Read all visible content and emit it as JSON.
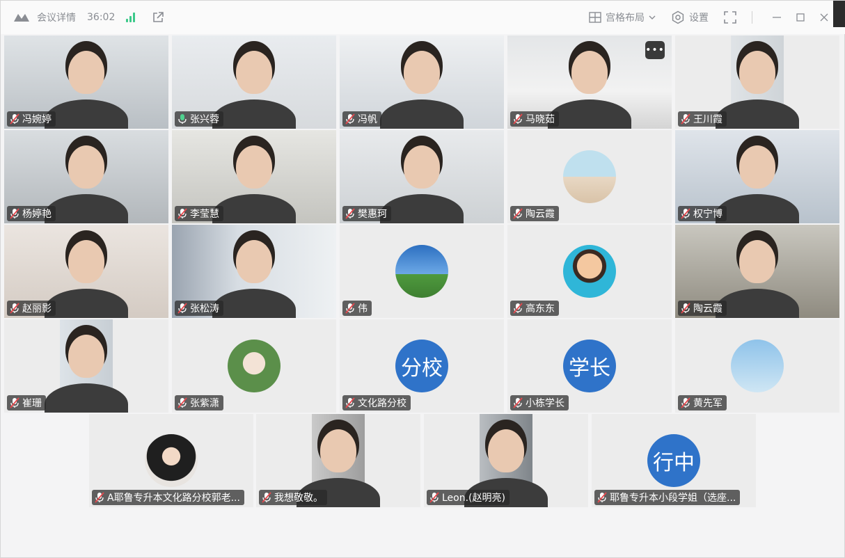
{
  "title_bar": {
    "meeting_details_label": "会议详情",
    "duration": "36:02",
    "layout_label": "宫格布局",
    "settings_label": "设置"
  },
  "colors": {
    "active_speaker_border": "#35c38a",
    "text_avatar_bg": "#2f73c9",
    "nametag_bg": "#282828"
  },
  "participants": [
    {
      "name": "冯婉婷",
      "kind": "video",
      "muted": true
    },
    {
      "name": "张兴蓉",
      "kind": "video",
      "muted": false,
      "speaking": true
    },
    {
      "name": "冯帆",
      "kind": "video",
      "muted": true
    },
    {
      "name": "马晓茹",
      "kind": "video",
      "muted": true
    },
    {
      "name": "王川霞",
      "kind": "video",
      "muted": true
    },
    {
      "name": "杨婷艳",
      "kind": "video",
      "muted": true
    },
    {
      "name": "李莹慧",
      "kind": "video",
      "muted": true
    },
    {
      "name": "樊惠珂",
      "kind": "video",
      "muted": true
    },
    {
      "name": "陶云霞",
      "kind": "avatar",
      "muted": true
    },
    {
      "name": "权宁博",
      "kind": "video",
      "muted": true
    },
    {
      "name": "赵丽影",
      "kind": "video",
      "muted": true
    },
    {
      "name": "张松涛",
      "kind": "video",
      "muted": true
    },
    {
      "name": "伟",
      "kind": "avatar",
      "muted": true
    },
    {
      "name": "高东东",
      "kind": "avatar",
      "muted": true
    },
    {
      "name": "陶云霞",
      "kind": "video",
      "muted": true
    },
    {
      "name": "崔珊",
      "kind": "video",
      "muted": true
    },
    {
      "name": "张紫潇",
      "kind": "avatar",
      "muted": true
    },
    {
      "name": "文化路分校",
      "kind": "text-avatar",
      "avatar_text": "分校",
      "muted": true
    },
    {
      "name": "小栋学长",
      "kind": "text-avatar",
      "avatar_text": "学长",
      "muted": true
    },
    {
      "name": "黄先军",
      "kind": "avatar",
      "muted": true
    },
    {
      "name": "A耶鲁专升本文化路分校郭老...",
      "kind": "avatar",
      "muted": true
    },
    {
      "name": "我想敬敬。",
      "kind": "video",
      "muted": true
    },
    {
      "name": "Leon.(赵明亮)",
      "kind": "video",
      "muted": true
    },
    {
      "name": "耶鲁专升本小段学姐（选座...",
      "kind": "text-avatar",
      "avatar_text": "行中",
      "muted": true
    }
  ]
}
